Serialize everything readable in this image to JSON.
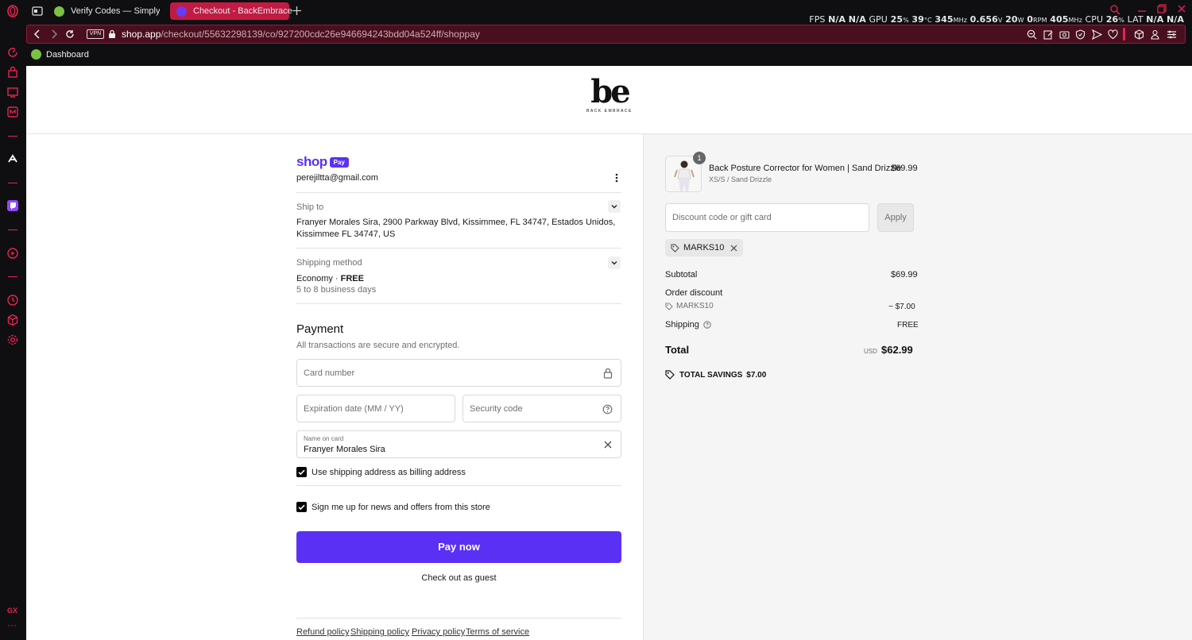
{
  "browser": {
    "tabs": [
      {
        "label": "Verify Codes — SimplyCodes",
        "active": false
      },
      {
        "label": "Checkout - BackEmbrace",
        "active": true
      }
    ],
    "address": {
      "vpn_badge": "VPN",
      "host": "shop.app",
      "path": "/checkout/55632298139/co/927200cdc26e946694243bdd04a524ff/shoppay"
    },
    "bookmark": "Dashboard",
    "hud": {
      "fps_label": "FPS",
      "fps": "N/A",
      "fps2": "N/A",
      "gpu_label": "GPU",
      "gpu_pct": "25",
      "pct": "%",
      "gpu_temp": "39",
      "temp_unit": "°C",
      "gpu_mhz": "345",
      "mhz": "MHz",
      "gpu_v": "0.656",
      "v": "V",
      "gpu_w": "20",
      "w": "W",
      "rpm_val": "0",
      "rpm": "RPM",
      "mem_mhz": "405",
      "cpu_label": "CPU",
      "cpu_pct": "26",
      "lat_label": "LAT",
      "lat": "N/A",
      "lat2": "N/A"
    },
    "accent": "#e8244f"
  },
  "brand": {
    "logo_text": "be",
    "logo_sub": "BACK EMBRACE"
  },
  "shop": {
    "logo_word": "shop",
    "pay_badge": "Pay",
    "email": "perejiltta@gmail.com",
    "ship_to_label": "Ship to",
    "ship_to_value": "Franyer Morales Sira, 2900 Parkway Blvd, Kissimmee, FL 34747, Estados Unidos, Kissimmee FL 34747, US",
    "shipping_method_label": "Shipping method",
    "shipping_method_value": "Economy · ",
    "shipping_method_price": "FREE",
    "shipping_method_eta": "5 to 8 business days"
  },
  "payment": {
    "title": "Payment",
    "subtitle": "All transactions are secure and encrypted.",
    "card_number_placeholder": "Card number",
    "expiry_placeholder": "Expiration date (MM / YY)",
    "security_placeholder": "Security code",
    "name_label": "Name on card",
    "name_value": "Franyer Morales Sira",
    "billing_checkbox": "Use shipping address as billing address",
    "news_checkbox": "Sign me up for news and offers from this store",
    "pay_button": "Pay now",
    "guest_link": "Check out as guest",
    "pay_color": "#5a31f4"
  },
  "footer_links": [
    "Refund policy",
    "Shipping policy",
    "Privacy policy",
    "Terms of service"
  ],
  "summary": {
    "item": {
      "qty": "1",
      "name": "Back Posture Corrector for Women | Sand Drizzle",
      "variant": "XS/S / Sand Drizzle",
      "price": "$69.99"
    },
    "discount_placeholder": "Discount code or gift card",
    "apply_button": "Apply",
    "applied_code": "MARKS10",
    "subtotal_label": "Subtotal",
    "subtotal_value": "$69.99",
    "order_discount_label": "Order discount",
    "discount_code": "MARKS10",
    "discount_value": "− $7.00",
    "shipping_label": "Shipping",
    "shipping_value": "FREE",
    "total_label": "Total",
    "currency": "USD",
    "total_value": "$62.99",
    "savings_label": "TOTAL SAVINGS",
    "savings_value": "$7.00"
  }
}
